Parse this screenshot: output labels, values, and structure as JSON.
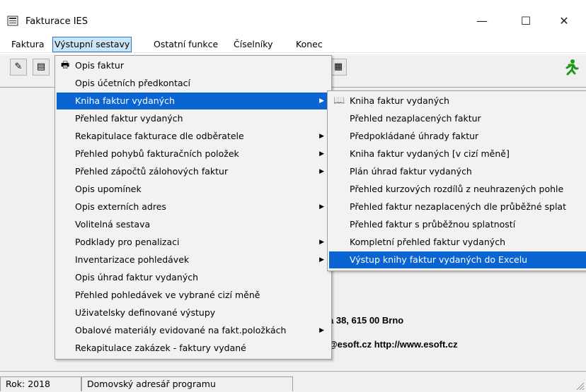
{
  "window": {
    "title": "Fakturace IES",
    "minimize_glyph": "—",
    "maximize_glyph": "☐",
    "close_glyph": "✕"
  },
  "menubar": [
    "Faktura",
    "Výstupní sestavy",
    "Ostatní funkce",
    "Číselníky",
    "Konec"
  ],
  "dropdown": [
    "Opis faktur",
    "Opis účetních předkontací",
    "Kniha faktur vydaných",
    "Přehled faktur vydaných",
    "Rekapitulace fakturace dle odběratele",
    "Přehled pohybů fakturačních položek",
    "Přehled zápočtů zálohových faktur",
    "Opis upomínek",
    "Opis externích adres",
    "Volitelná sestava",
    "Podklady pro penalizaci",
    "Inventarizace pohledávek",
    "Opis úhrad faktur vydaných",
    "Přehled pohledávek ve vybrané cizí měně",
    "Uživatelsky definované výstupy",
    "Obalové materiály evidované na fakt.položkách",
    "Rekapitulace zakázek - faktury vydané"
  ],
  "submenu": [
    "Kniha faktur vydaných",
    "Přehled nezaplacených faktur",
    "Předpokládané úhrady faktur",
    "Kniha faktur vydaných [v cizí měně]",
    "Plán úhrad faktur vydaných",
    "Přehled kurzových rozdílů z neuhrazených pohle",
    "Přehled faktur nezaplacených dle průběžné splat",
    "Přehled faktur s průběžnou splatností",
    "Kompletní přehled faktur vydaných",
    "Výstup knihy faktur vydaných do Excelu"
  ],
  "client": {
    "address": "a 38, 615 00 Brno",
    "contact": "@esoft.cz  http://www.esoft.cz"
  },
  "status": {
    "year": "Rok: 2018",
    "home": "Domovský adresář programu"
  },
  "colors": {
    "highlight": "#0a64d2",
    "menu_bg": "#f2f2f2",
    "active_menu": "#cce4f7"
  },
  "icons": {
    "exit": "green-running-man-icon",
    "print": "printer-icon",
    "book": "open-book-icon"
  }
}
